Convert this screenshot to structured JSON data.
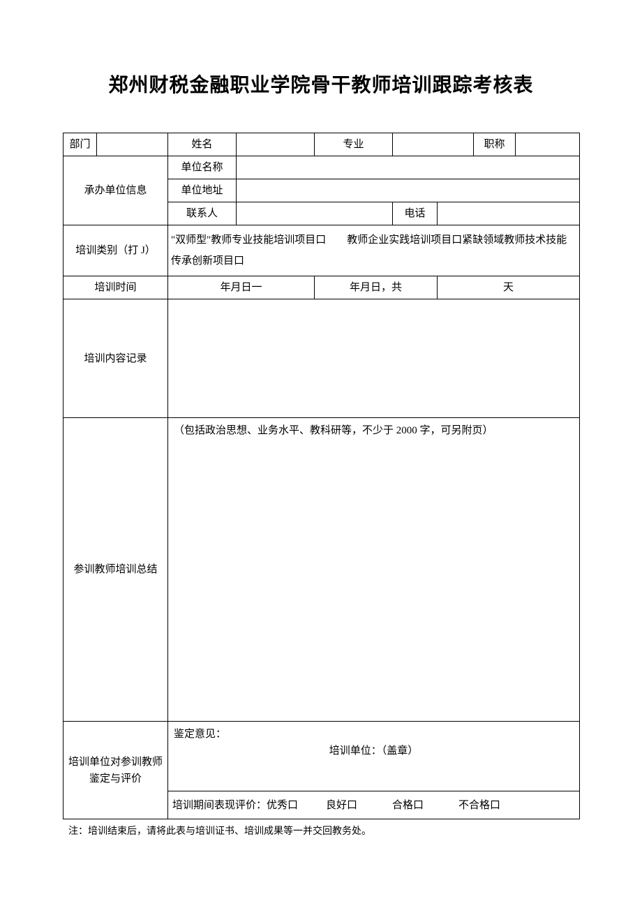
{
  "title": "郑州财税金融职业学院骨干教师培训跟踪考核表",
  "row1": {
    "dept_label": "部门",
    "name_label": "姓名",
    "major_label": "专业",
    "title_label": "职称"
  },
  "host": {
    "section_label": "承办单位信息",
    "unit_name_label": "单位名称",
    "unit_addr_label": "单位地址",
    "contact_label": "联系人",
    "phone_label": "电话"
  },
  "category": {
    "label": "培训类别（打 J）",
    "text": "\"双师型\"教师专业技能培训项目口　　教师企业实践培训项目口紧缺领域教师技术技能传承创新项目口"
  },
  "time": {
    "label": "培训时间",
    "start": "年月日一",
    "end": "年月日，共",
    "days_unit": "天"
  },
  "content": {
    "label": "培训内容记录"
  },
  "summary": {
    "label": "参训教师培训总结",
    "hint": "（包括政治思想、业务水平、教科研等，不少于 2000 字，可另附页）"
  },
  "eval": {
    "label": "培训单位对参训教师鉴定与评价",
    "opinion_label": "鉴定意见：",
    "stamp": "培训单位：（盖章）",
    "rating_prefix": "培训期间表现评价：优秀口",
    "good": "良好口",
    "pass": "合格口",
    "fail": "不合格口"
  },
  "footnote": "注：培训结束后，请将此表与培训证书、培训成果等一并交回教务处。"
}
